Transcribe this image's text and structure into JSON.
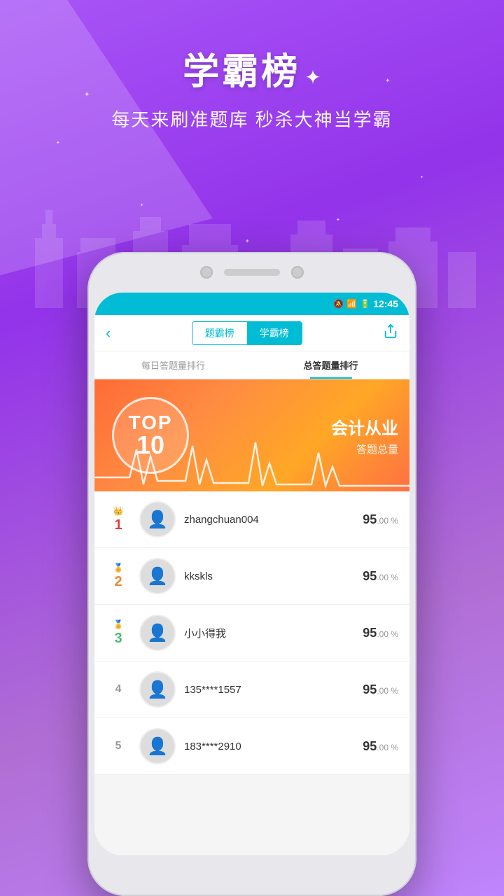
{
  "background": {
    "color_start": "#a855f7",
    "color_end": "#c084fc"
  },
  "header": {
    "title": "学霸榜",
    "sparkle": "✦",
    "subtitle": "每天来刷准题库 秒杀大神当学霸"
  },
  "status_bar": {
    "time": "12:45",
    "mute_icon": "🔇",
    "signal_icon": "📶",
    "battery_icon": "🔋"
  },
  "nav": {
    "back_label": "‹",
    "tab1_label": "题霸榜",
    "tab2_label": "学霸榜",
    "share_label": "⎋"
  },
  "sub_tabs": {
    "tab1_label": "每日答题量排行",
    "tab2_label": "总答题量排行"
  },
  "banner": {
    "top_text": "TOP",
    "num_text": "10",
    "category": "会计从业",
    "metric": "答题总量"
  },
  "rankings": [
    {
      "rank": "1",
      "rank_class": "r1",
      "crown": "👑",
      "crown_class": "crown-1",
      "name": "zhangchuan004",
      "score_big": "95",
      "score_small": ".00 %"
    },
    {
      "rank": "2",
      "rank_class": "r2",
      "crown": "🏅",
      "crown_class": "crown-2",
      "name": "kkskls",
      "score_big": "95",
      "score_small": ".00 %"
    },
    {
      "rank": "3",
      "rank_class": "r3",
      "crown": "🏅",
      "crown_class": "crown-3",
      "name": "小小得我",
      "score_big": "95",
      "score_small": ".00 %"
    },
    {
      "rank": "4",
      "rank_class": "r4",
      "crown": "",
      "crown_class": "",
      "name": "135****1557",
      "score_big": "95",
      "score_small": ".00 %"
    },
    {
      "rank": "5",
      "rank_class": "r4",
      "crown": "",
      "crown_class": "",
      "name": "183****2910",
      "score_big": "95",
      "score_small": ".00 %"
    }
  ]
}
